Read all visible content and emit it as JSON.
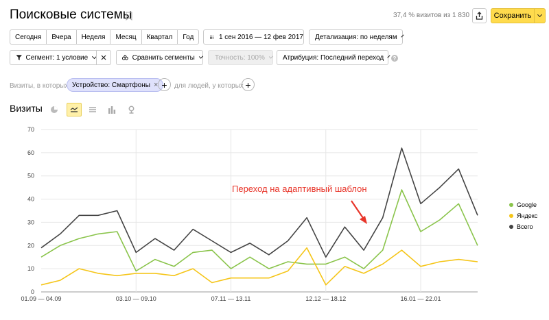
{
  "header": {
    "title": "Поисковые системы",
    "visits_share": "37,4 % визитов из 1 830",
    "save_label": "Сохранить"
  },
  "periods": [
    "Сегодня",
    "Вчера",
    "Неделя",
    "Месяц",
    "Квартал",
    "Год"
  ],
  "date_range": "1 сен 2016 — 12 фев 2017",
  "detail": "Детализация: по неделям",
  "toolbar": {
    "segment": "Сегмент: 1 условие",
    "compare": "Сравнить сегменты",
    "accuracy": "Точность: 100%",
    "attribution": "Атрибуция: Последний переход"
  },
  "filter": {
    "prefix": "Визиты, в которых",
    "condition": "Устройство: Смартфоны",
    "people": "для людей, у которых"
  },
  "section_title": "Визиты",
  "chart_data": {
    "type": "line",
    "annotation": "Переход на адаптивный шаблон",
    "ylim": [
      0,
      70
    ],
    "yticks": [
      0,
      10,
      20,
      30,
      40,
      50,
      60,
      70
    ],
    "xtick_labels": [
      "01.09 — 04.09",
      "03.10 — 09.10",
      "07.11 — 13.11",
      "12.12 — 18.12",
      "16.01 — 22.01"
    ],
    "xtick_index": [
      0,
      5,
      10,
      15,
      20
    ],
    "series": [
      {
        "name": "Google",
        "color": "#8ac44b",
        "values": [
          15,
          20,
          23,
          25,
          26,
          9,
          14,
          11,
          17,
          18,
          10,
          15,
          10,
          13,
          12,
          12,
          15,
          10,
          18,
          44,
          26,
          31,
          38,
          20
        ]
      },
      {
        "name": "Яндекс",
        "color": "#f5c518",
        "values": [
          3,
          5,
          10,
          8,
          7,
          8,
          8,
          7,
          10,
          4,
          6,
          6,
          6,
          9,
          19,
          3,
          11,
          8,
          12,
          18,
          11,
          13,
          14,
          13
        ]
      },
      {
        "name": "Всего",
        "color": "#444444",
        "values": [
          19,
          25,
          33,
          33,
          35,
          17,
          23,
          18,
          27,
          22,
          17,
          21,
          16,
          22,
          32,
          15,
          28,
          18,
          32,
          62,
          38,
          45,
          53,
          33
        ]
      }
    ]
  }
}
